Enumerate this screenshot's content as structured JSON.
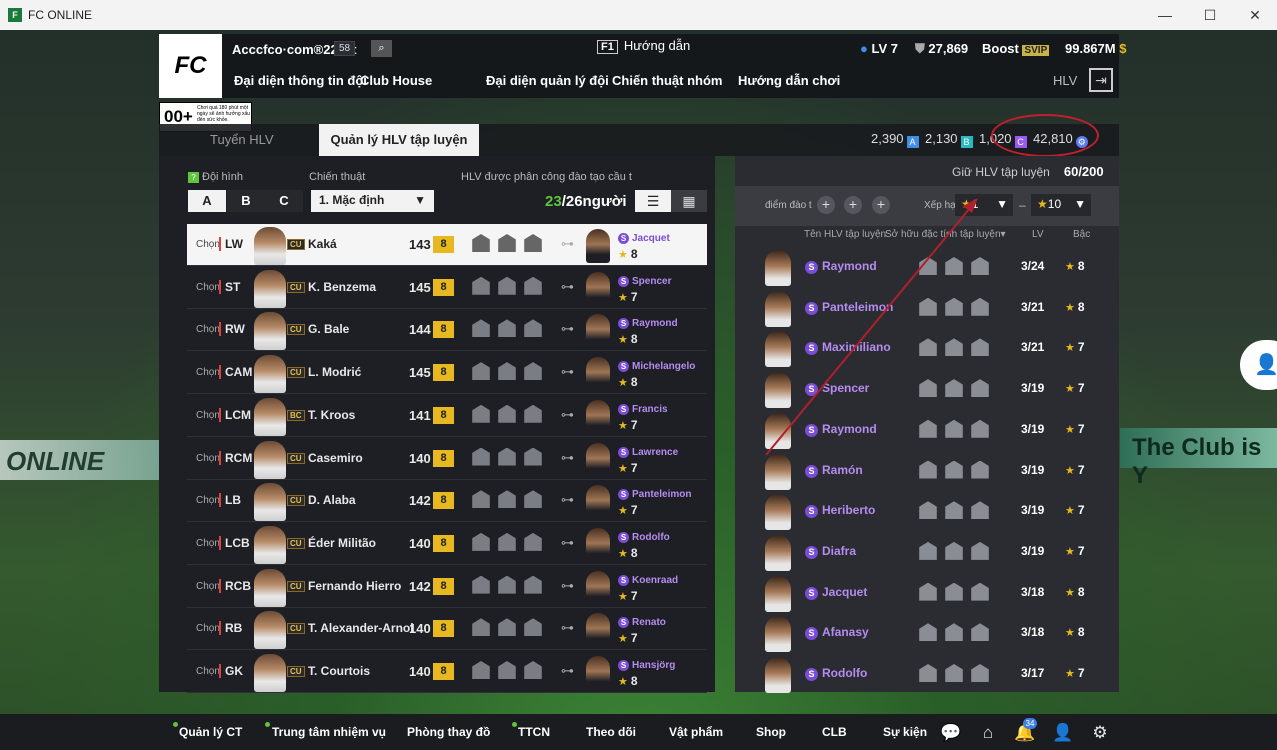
{
  "window": {
    "title": "FC ONLINE",
    "min": "—",
    "max": "☐",
    "close": "✕"
  },
  "header": {
    "logo": "FC",
    "username": "Acccfco·com®2209t",
    "badge": "58",
    "guide_key": "F1",
    "guide_label": "Hướng dẫn",
    "level": "LV 7",
    "coins": "27,869",
    "boost_label": "Boost",
    "boost_badge": "SVIP",
    "fc_points": "99.867M"
  },
  "nav": [
    "Đại diện thông tin đội",
    "Club House",
    "Đại diện quản lý đội",
    "Chiến thuật nhóm",
    "Hướng dẫn chơi",
    "HLV"
  ],
  "age_rating": {
    "badge": "00+",
    "text": "Chơi quá 180 phút một ngày sẽ ảnh hưởng xấu đến sức khỏe."
  },
  "tabs": {
    "recruit": "Tuyển HLV",
    "manage": "Quản lý HLV tập luyện"
  },
  "currencies": [
    {
      "value": "2,390",
      "color": "#3f8fe6",
      "icon": "A"
    },
    {
      "value": "2,130",
      "color": "#2ab8c0",
      "icon": "B"
    },
    {
      "value": "1,020",
      "color": "#9a5cf0",
      "icon": "C"
    },
    {
      "value": "42,810",
      "color": "#5c7cf0",
      "icon": "⚙"
    }
  ],
  "left": {
    "formation_label": "Đội hình",
    "formations": [
      "A",
      "B",
      "C"
    ],
    "tactic_label": "Chiến thuật",
    "tactic_value": "1. Mặc định",
    "assign_label": "HLV được phân công đào tạo cầu t",
    "assigned": "23",
    "assign_total": "/26người",
    "choose": "Chọn"
  },
  "players": [
    {
      "pos": "LW",
      "card": "CU",
      "name": "Kaká",
      "ovr": "143",
      "lvl": "8",
      "coach": "Jacquet",
      "stars": "8"
    },
    {
      "pos": "ST",
      "card": "CU",
      "name": "K. Benzema",
      "ovr": "145",
      "lvl": "8",
      "coach": "Spencer",
      "stars": "7"
    },
    {
      "pos": "RW",
      "card": "CU",
      "name": "G. Bale",
      "ovr": "144",
      "lvl": "8",
      "coach": "Raymond",
      "stars": "8"
    },
    {
      "pos": "CAM",
      "card": "CU",
      "name": "L. Modrić",
      "ovr": "145",
      "lvl": "8",
      "coach": "Michelangelo",
      "stars": "8"
    },
    {
      "pos": "LCM",
      "card": "BC",
      "name": "T. Kroos",
      "ovr": "141",
      "lvl": "8",
      "coach": "Francis",
      "stars": "7"
    },
    {
      "pos": "RCM",
      "card": "CU",
      "name": "Casemiro",
      "ovr": "140",
      "lvl": "8",
      "coach": "Lawrence",
      "stars": "7"
    },
    {
      "pos": "LB",
      "card": "CU",
      "name": "D. Alaba",
      "ovr": "142",
      "lvl": "8",
      "coach": "Panteleimon",
      "stars": "7"
    },
    {
      "pos": "LCB",
      "card": "CU",
      "name": "Éder Militão",
      "ovr": "140",
      "lvl": "8",
      "coach": "Rodolfo",
      "stars": "8"
    },
    {
      "pos": "RCB",
      "card": "CU",
      "name": "Fernando Hierro",
      "ovr": "142",
      "lvl": "8",
      "coach": "Koenraad",
      "stars": "7"
    },
    {
      "pos": "RB",
      "card": "CU",
      "name": "T. Alexander-Arnol",
      "ovr": "140",
      "lvl": "8",
      "coach": "Renato",
      "stars": "7"
    },
    {
      "pos": "GK",
      "card": "CU",
      "name": "T. Courtois",
      "ovr": "140",
      "lvl": "8",
      "coach": "Hansjörg",
      "stars": "8"
    }
  ],
  "right": {
    "hold_label": "Giữ HLV tập luyện",
    "hold_value": "60/200",
    "points_label": "điểm đào t",
    "sort_label": "Xếp hạ",
    "sort_min": "1",
    "sort_dash": "–",
    "sort_max": "10",
    "col_name": "Tên HLV tập luyện",
    "col_ability": "Sở hữu đặc tính tập luyện",
    "col_lv": "LV",
    "col_grade": "Bậc"
  },
  "coaches": [
    {
      "name": "Raymond",
      "lv": "3/24",
      "grade": "8"
    },
    {
      "name": "Panteleimon",
      "lv": "3/21",
      "grade": "8"
    },
    {
      "name": "Maximiliano",
      "lv": "3/21",
      "grade": "7"
    },
    {
      "name": "Spencer",
      "lv": "3/19",
      "grade": "7"
    },
    {
      "name": "Raymond",
      "lv": "3/19",
      "grade": "7"
    },
    {
      "name": "Ramón",
      "lv": "3/19",
      "grade": "7"
    },
    {
      "name": "Heriberto",
      "lv": "3/19",
      "grade": "7"
    },
    {
      "name": "Diafra",
      "lv": "3/19",
      "grade": "7"
    },
    {
      "name": "Jacquet",
      "lv": "3/18",
      "grade": "8"
    },
    {
      "name": "Afanasy",
      "lv": "3/18",
      "grade": "8"
    },
    {
      "name": "Rodolfo",
      "lv": "3/17",
      "grade": "7"
    }
  ],
  "bottom": [
    "Quản lý CT",
    "Trung tâm nhiệm vụ",
    "Phòng thay đồ",
    "TTCN",
    "Theo dõi",
    "Vật phẩm",
    "Shop",
    "CLB",
    "Sự kiện"
  ],
  "notif_count": "34",
  "stadium": {
    "left_text": "ONLINE",
    "right_text": "The Club is Y"
  }
}
